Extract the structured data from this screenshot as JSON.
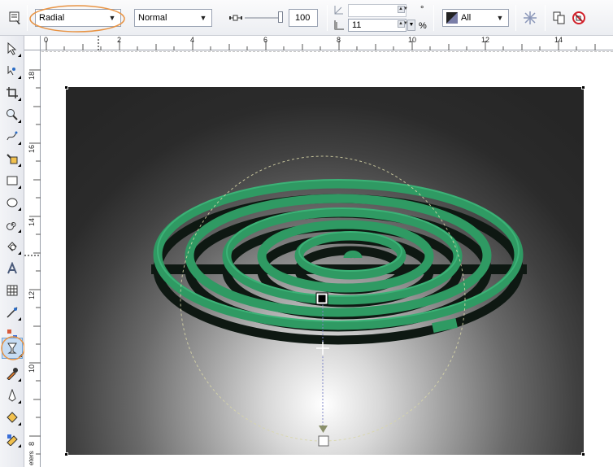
{
  "property_bar": {
    "fill_type": "Radial",
    "merge_mode": "Normal",
    "midpoint_value": "100",
    "angle_value": "",
    "steps_value": "11",
    "degree_symbol": "°",
    "percent_symbol": "%",
    "target_value": "All"
  },
  "rulers": {
    "horizontal_labels": [
      "0",
      "2",
      "4",
      "6",
      "8",
      "10",
      "12",
      "14"
    ],
    "vertical_labels": [
      "18",
      "16",
      "14",
      "12",
      "10",
      "8"
    ],
    "units_label": "eters"
  },
  "colors": {
    "coil_top": "#2f9a63",
    "coil_side": "#0d1a12",
    "highlight_circle": "#e89343",
    "selection_active": "#c6dcf3"
  }
}
